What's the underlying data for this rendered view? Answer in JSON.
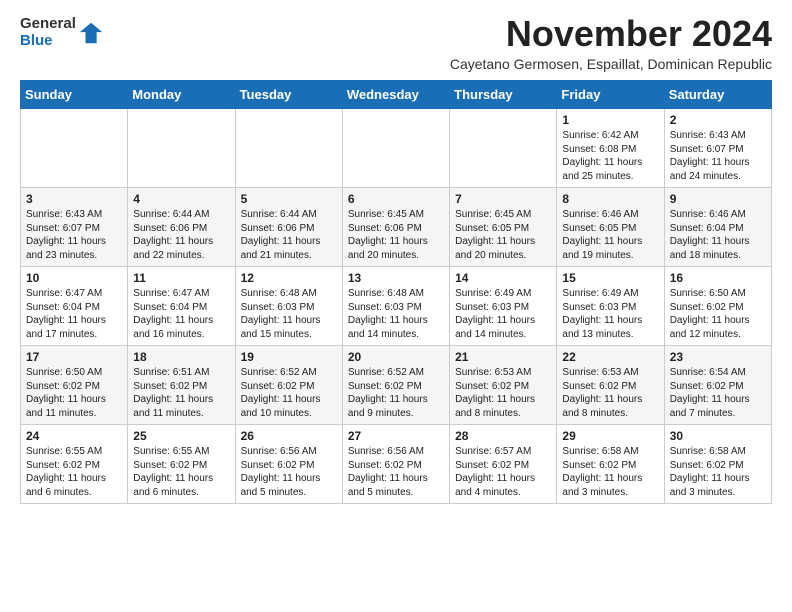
{
  "header": {
    "logo_line1": "General",
    "logo_line2": "Blue",
    "month_title": "November 2024",
    "subtitle": "Cayetano Germosen, Espaillat, Dominican Republic"
  },
  "weekdays": [
    "Sunday",
    "Monday",
    "Tuesday",
    "Wednesday",
    "Thursday",
    "Friday",
    "Saturday"
  ],
  "weeks": [
    [
      {
        "day": "",
        "info": ""
      },
      {
        "day": "",
        "info": ""
      },
      {
        "day": "",
        "info": ""
      },
      {
        "day": "",
        "info": ""
      },
      {
        "day": "",
        "info": ""
      },
      {
        "day": "1",
        "info": "Sunrise: 6:42 AM\nSunset: 6:08 PM\nDaylight: 11 hours\nand 25 minutes."
      },
      {
        "day": "2",
        "info": "Sunrise: 6:43 AM\nSunset: 6:07 PM\nDaylight: 11 hours\nand 24 minutes."
      }
    ],
    [
      {
        "day": "3",
        "info": "Sunrise: 6:43 AM\nSunset: 6:07 PM\nDaylight: 11 hours\nand 23 minutes."
      },
      {
        "day": "4",
        "info": "Sunrise: 6:44 AM\nSunset: 6:06 PM\nDaylight: 11 hours\nand 22 minutes."
      },
      {
        "day": "5",
        "info": "Sunrise: 6:44 AM\nSunset: 6:06 PM\nDaylight: 11 hours\nand 21 minutes."
      },
      {
        "day": "6",
        "info": "Sunrise: 6:45 AM\nSunset: 6:06 PM\nDaylight: 11 hours\nand 20 minutes."
      },
      {
        "day": "7",
        "info": "Sunrise: 6:45 AM\nSunset: 6:05 PM\nDaylight: 11 hours\nand 20 minutes."
      },
      {
        "day": "8",
        "info": "Sunrise: 6:46 AM\nSunset: 6:05 PM\nDaylight: 11 hours\nand 19 minutes."
      },
      {
        "day": "9",
        "info": "Sunrise: 6:46 AM\nSunset: 6:04 PM\nDaylight: 11 hours\nand 18 minutes."
      }
    ],
    [
      {
        "day": "10",
        "info": "Sunrise: 6:47 AM\nSunset: 6:04 PM\nDaylight: 11 hours\nand 17 minutes."
      },
      {
        "day": "11",
        "info": "Sunrise: 6:47 AM\nSunset: 6:04 PM\nDaylight: 11 hours\nand 16 minutes."
      },
      {
        "day": "12",
        "info": "Sunrise: 6:48 AM\nSunset: 6:03 PM\nDaylight: 11 hours\nand 15 minutes."
      },
      {
        "day": "13",
        "info": "Sunrise: 6:48 AM\nSunset: 6:03 PM\nDaylight: 11 hours\nand 14 minutes."
      },
      {
        "day": "14",
        "info": "Sunrise: 6:49 AM\nSunset: 6:03 PM\nDaylight: 11 hours\nand 14 minutes."
      },
      {
        "day": "15",
        "info": "Sunrise: 6:49 AM\nSunset: 6:03 PM\nDaylight: 11 hours\nand 13 minutes."
      },
      {
        "day": "16",
        "info": "Sunrise: 6:50 AM\nSunset: 6:02 PM\nDaylight: 11 hours\nand 12 minutes."
      }
    ],
    [
      {
        "day": "17",
        "info": "Sunrise: 6:50 AM\nSunset: 6:02 PM\nDaylight: 11 hours\nand 11 minutes."
      },
      {
        "day": "18",
        "info": "Sunrise: 6:51 AM\nSunset: 6:02 PM\nDaylight: 11 hours\nand 11 minutes."
      },
      {
        "day": "19",
        "info": "Sunrise: 6:52 AM\nSunset: 6:02 PM\nDaylight: 11 hours\nand 10 minutes."
      },
      {
        "day": "20",
        "info": "Sunrise: 6:52 AM\nSunset: 6:02 PM\nDaylight: 11 hours\nand 9 minutes."
      },
      {
        "day": "21",
        "info": "Sunrise: 6:53 AM\nSunset: 6:02 PM\nDaylight: 11 hours\nand 8 minutes."
      },
      {
        "day": "22",
        "info": "Sunrise: 6:53 AM\nSunset: 6:02 PM\nDaylight: 11 hours\nand 8 minutes."
      },
      {
        "day": "23",
        "info": "Sunrise: 6:54 AM\nSunset: 6:02 PM\nDaylight: 11 hours\nand 7 minutes."
      }
    ],
    [
      {
        "day": "24",
        "info": "Sunrise: 6:55 AM\nSunset: 6:02 PM\nDaylight: 11 hours\nand 6 minutes."
      },
      {
        "day": "25",
        "info": "Sunrise: 6:55 AM\nSunset: 6:02 PM\nDaylight: 11 hours\nand 6 minutes."
      },
      {
        "day": "26",
        "info": "Sunrise: 6:56 AM\nSunset: 6:02 PM\nDaylight: 11 hours\nand 5 minutes."
      },
      {
        "day": "27",
        "info": "Sunrise: 6:56 AM\nSunset: 6:02 PM\nDaylight: 11 hours\nand 5 minutes."
      },
      {
        "day": "28",
        "info": "Sunrise: 6:57 AM\nSunset: 6:02 PM\nDaylight: 11 hours\nand 4 minutes."
      },
      {
        "day": "29",
        "info": "Sunrise: 6:58 AM\nSunset: 6:02 PM\nDaylight: 11 hours\nand 3 minutes."
      },
      {
        "day": "30",
        "info": "Sunrise: 6:58 AM\nSunset: 6:02 PM\nDaylight: 11 hours\nand 3 minutes."
      }
    ]
  ]
}
